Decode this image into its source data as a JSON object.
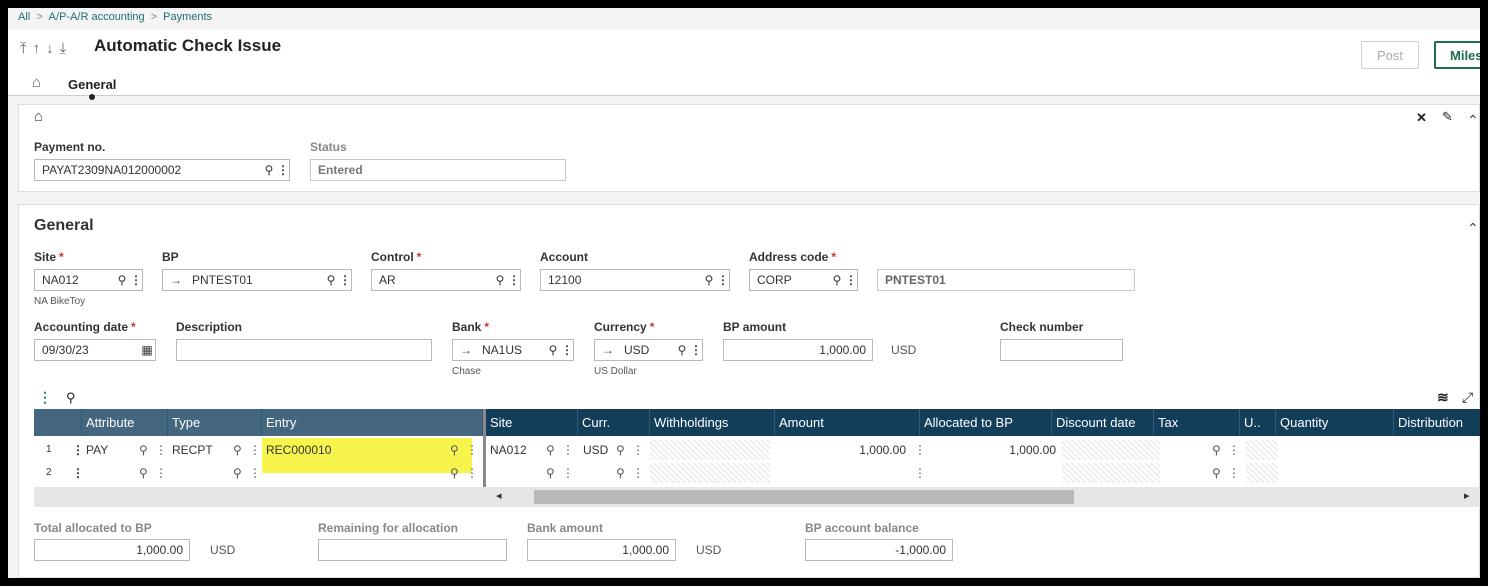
{
  "breadcrumb": {
    "items": [
      "All",
      "A/P-A/R accounting",
      "Payments"
    ],
    "sep": ">"
  },
  "nav": {
    "first": "⤒",
    "up": "↑",
    "down": "↓",
    "last": "⤓"
  },
  "title": "Automatic Check Issue",
  "actions": {
    "post": "Post",
    "miles": "Miles"
  },
  "tabs": {
    "home_icon": "⌂",
    "general": "General"
  },
  "header_panel": {
    "home_icon": "⌂",
    "tools": {
      "settings": "✕",
      "edit": "✎",
      "collapse": "⌃"
    },
    "payment_no": {
      "label": "Payment no.",
      "value": "PAYAT2309NA012000002"
    },
    "status": {
      "label": "Status",
      "value": "Entered"
    }
  },
  "general": {
    "title": "General",
    "collapse": "⌃",
    "site": {
      "label": "Site",
      "value": "NA012",
      "sub": "NA BikeToy"
    },
    "bp": {
      "label": "BP",
      "value": "PNTEST01"
    },
    "control": {
      "label": "Control",
      "value": "AR"
    },
    "account": {
      "label": "Account",
      "value": "12100"
    },
    "address_code": {
      "label": "Address code",
      "value": "CORP",
      "extra": "PNTEST01"
    },
    "accounting_date": {
      "label": "Accounting date",
      "value": "09/30/23"
    },
    "description": {
      "label": "Description",
      "value": ""
    },
    "bank": {
      "label": "Bank",
      "value": "NA1US",
      "sub": "Chase"
    },
    "currency": {
      "label": "Currency",
      "value": "USD",
      "sub": "US Dollar"
    },
    "bp_amount": {
      "label": "BP amount",
      "value": "1,000.00",
      "unit": "USD"
    },
    "check_number": {
      "label": "Check number",
      "value": ""
    }
  },
  "grid": {
    "columns_left": [
      "Attribute",
      "Type",
      "Entry"
    ],
    "columns_right": [
      "Site",
      "Curr.",
      "Withholdings",
      "Amount",
      "Allocated to BP",
      "Discount date",
      "Tax",
      "U..",
      "Quantity",
      "Distribution"
    ],
    "rows": [
      {
        "num": "1",
        "attribute": "PAY",
        "type": "RECPT",
        "entry": "REC000010",
        "site": "NA012",
        "curr": "USD",
        "amount": "1,000.00",
        "allocated": "1,000.00"
      },
      {
        "num": "2",
        "attribute": "",
        "type": "",
        "entry": "",
        "site": "",
        "curr": "",
        "amount": "",
        "allocated": ""
      }
    ],
    "icons": {
      "menu": "⋮",
      "search": "⚲",
      "layers": "≋",
      "expand": "⤢"
    }
  },
  "totals": {
    "total_allocated": {
      "label": "Total allocated to BP",
      "value": "1,000.00",
      "unit": "USD"
    },
    "remaining": {
      "label": "Remaining for allocation",
      "value": ""
    },
    "bank_amount": {
      "label": "Bank amount",
      "value": "1,000.00",
      "unit": "USD"
    },
    "bp_balance": {
      "label": "BP account balance",
      "value": "-1,000.00"
    }
  }
}
